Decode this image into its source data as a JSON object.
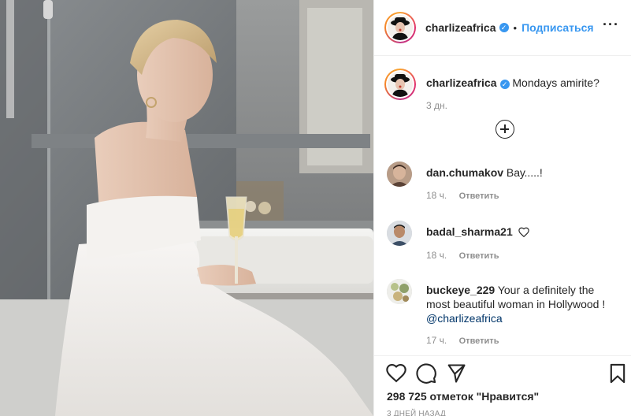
{
  "post": {
    "image_alt": "Woman in a white strapless feathered dress sitting on the edge of a bathtub holding a glass of champagne"
  },
  "header": {
    "username": "charlizeafrica",
    "verified_symbol": "✓",
    "separator": "•",
    "follow_label": "Подписаться",
    "more_label": "···"
  },
  "caption": {
    "username": "charlizeafrica",
    "text": "Mondays amirite?",
    "time": "3 дн."
  },
  "comments": [
    {
      "username": "dan.chumakov",
      "text": "Вау.....!",
      "time": "18 ч.",
      "reply_label": "Ответить",
      "avatar_color": "#7a5a48"
    },
    {
      "username": "badal_sharma21",
      "text": "",
      "time": "18 ч.",
      "reply_label": "Ответить",
      "avatar_color": "#4b5a6b"
    },
    {
      "username": "buckeye_229",
      "text": "Your a definitely the most beautiful woman in Hollywood ! ",
      "mention": "@charlizeafrica",
      "time": "17 ч.",
      "reply_label": "Ответить",
      "avatar_color": "#9aa57a"
    }
  ],
  "actions": {
    "like_icon": "heart-icon",
    "comment_icon": "comment-icon",
    "share_icon": "share-icon",
    "save_icon": "bookmark-icon",
    "likes_text": "298 725 отметок \"Нравится\"",
    "age_text": "3 ДНЕЙ НАЗАД"
  },
  "colors": {
    "link": "#3897f0",
    "text": "#262626",
    "muted": "#8e8e8e",
    "border": "#efefef"
  }
}
